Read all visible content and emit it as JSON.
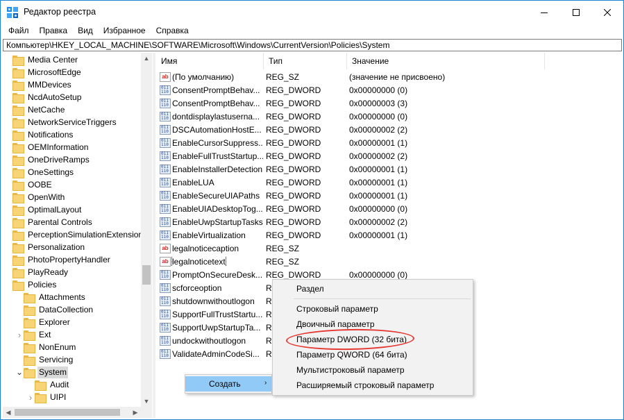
{
  "window": {
    "title": "Редактор реестра",
    "controls": {
      "minimize": "minimize",
      "maximize": "maximize",
      "close": "close"
    }
  },
  "menubar": [
    "Файл",
    "Правка",
    "Вид",
    "Избранное",
    "Справка"
  ],
  "address": "Компьютер\\HKEY_LOCAL_MACHINE\\SOFTWARE\\Microsoft\\Windows\\CurrentVersion\\Policies\\System",
  "tree": {
    "items": [
      {
        "label": "Media Center",
        "level": 0,
        "expander": ""
      },
      {
        "label": "MicrosoftEdge",
        "level": 0,
        "expander": ""
      },
      {
        "label": "MMDevices",
        "level": 0,
        "expander": ""
      },
      {
        "label": "NcdAutoSetup",
        "level": 0,
        "expander": ""
      },
      {
        "label": "NetCache",
        "level": 0,
        "expander": ""
      },
      {
        "label": "NetworkServiceTriggers",
        "level": 0,
        "expander": ""
      },
      {
        "label": "Notifications",
        "level": 0,
        "expander": ""
      },
      {
        "label": "OEMInformation",
        "level": 0,
        "expander": ""
      },
      {
        "label": "OneDriveRamps",
        "level": 0,
        "expander": ""
      },
      {
        "label": "OneSettings",
        "level": 0,
        "expander": ""
      },
      {
        "label": "OOBE",
        "level": 0,
        "expander": ""
      },
      {
        "label": "OpenWith",
        "level": 0,
        "expander": ""
      },
      {
        "label": "OptimalLayout",
        "level": 0,
        "expander": ""
      },
      {
        "label": "Parental Controls",
        "level": 0,
        "expander": ""
      },
      {
        "label": "PerceptionSimulationExtensions",
        "level": 0,
        "expander": ""
      },
      {
        "label": "Personalization",
        "level": 0,
        "expander": ""
      },
      {
        "label": "PhotoPropertyHandler",
        "level": 0,
        "expander": ""
      },
      {
        "label": "PlayReady",
        "level": 0,
        "expander": ""
      },
      {
        "label": "Policies",
        "level": 0,
        "expander": ""
      },
      {
        "label": "Attachments",
        "level": 1,
        "expander": ""
      },
      {
        "label": "DataCollection",
        "level": 1,
        "expander": ""
      },
      {
        "label": "Explorer",
        "level": 1,
        "expander": ""
      },
      {
        "label": "Ext",
        "level": 1,
        "expander": ">"
      },
      {
        "label": "NonEnum",
        "level": 1,
        "expander": ""
      },
      {
        "label": "Servicing",
        "level": 1,
        "expander": ""
      },
      {
        "label": "System",
        "level": 1,
        "expander": "v",
        "selected": true
      },
      {
        "label": "Audit",
        "level": 2,
        "expander": ""
      },
      {
        "label": "UIPI",
        "level": 2,
        "expander": ">"
      }
    ]
  },
  "list": {
    "headers": {
      "name": "Имя",
      "type": "Тип",
      "value": "Значение"
    },
    "rows": [
      {
        "icon": "string-value-icon",
        "name": "(По умолчанию)",
        "type": "REG_SZ",
        "value": "(значение не присвоено)"
      },
      {
        "icon": "dword-value-icon",
        "name": "ConsentPromptBehav...",
        "type": "REG_DWORD",
        "value": "0x00000000 (0)"
      },
      {
        "icon": "dword-value-icon",
        "name": "ConsentPromptBehav...",
        "type": "REG_DWORD",
        "value": "0x00000003 (3)"
      },
      {
        "icon": "dword-value-icon",
        "name": "dontdisplaylastuserna...",
        "type": "REG_DWORD",
        "value": "0x00000000 (0)"
      },
      {
        "icon": "dword-value-icon",
        "name": "DSCAutomationHostE...",
        "type": "REG_DWORD",
        "value": "0x00000002 (2)"
      },
      {
        "icon": "dword-value-icon",
        "name": "EnableCursorSuppress...",
        "type": "REG_DWORD",
        "value": "0x00000001 (1)"
      },
      {
        "icon": "dword-value-icon",
        "name": "EnableFullTrustStartup...",
        "type": "REG_DWORD",
        "value": "0x00000002 (2)"
      },
      {
        "icon": "dword-value-icon",
        "name": "EnableInstallerDetection",
        "type": "REG_DWORD",
        "value": "0x00000001 (1)"
      },
      {
        "icon": "dword-value-icon",
        "name": "EnableLUA",
        "type": "REG_DWORD",
        "value": "0x00000001 (1)"
      },
      {
        "icon": "dword-value-icon",
        "name": "EnableSecureUIAPaths",
        "type": "REG_DWORD",
        "value": "0x00000001 (1)"
      },
      {
        "icon": "dword-value-icon",
        "name": "EnableUIADesktopTog...",
        "type": "REG_DWORD",
        "value": "0x00000000 (0)"
      },
      {
        "icon": "dword-value-icon",
        "name": "EnableUwpStartupTasks",
        "type": "REG_DWORD",
        "value": "0x00000002 (2)"
      },
      {
        "icon": "dword-value-icon",
        "name": "EnableVirtualization",
        "type": "REG_DWORD",
        "value": "0x00000001 (1)"
      },
      {
        "icon": "string-value-icon",
        "name": "legalnoticecaption",
        "type": "REG_SZ",
        "value": ""
      },
      {
        "icon": "string-value-icon",
        "name": "legalnoticetext",
        "type": "REG_SZ",
        "value": "",
        "focused": true
      },
      {
        "icon": "dword-value-icon",
        "name": "PromptOnSecureDesk...",
        "type": "REG_DWORD",
        "value": "0x00000000 (0)"
      },
      {
        "icon": "dword-value-icon",
        "name": "scforceoption",
        "type": "RI",
        "value": ""
      },
      {
        "icon": "dword-value-icon",
        "name": "shutdownwithoutlogon",
        "type": "RI",
        "value": ""
      },
      {
        "icon": "dword-value-icon",
        "name": "SupportFullTrustStartu...",
        "type": "RI",
        "value": ""
      },
      {
        "icon": "dword-value-icon",
        "name": "SupportUwpStartupTa...",
        "type": "RI",
        "value": ""
      },
      {
        "icon": "dword-value-icon",
        "name": "undockwithoutlogon",
        "type": "RI",
        "value": ""
      },
      {
        "icon": "dword-value-icon",
        "name": "ValidateAdminCodeSi...",
        "type": "RI",
        "value": ""
      }
    ]
  },
  "context_menu": {
    "parent_label": "Создать",
    "submenu": [
      {
        "label": "Раздел",
        "group": 0
      },
      {
        "label": "Строковый параметр",
        "group": 1
      },
      {
        "label": "Двоичный параметр",
        "group": 1
      },
      {
        "label": "Параметр DWORD (32 бита)",
        "group": 1,
        "circled": true
      },
      {
        "label": "Параметр QWORD (64 бита)",
        "group": 1
      },
      {
        "label": "Мультистроковый параметр",
        "group": 1
      },
      {
        "label": "Расширяемый строковый параметр",
        "group": 1
      }
    ],
    "annotation_color": "#e53935"
  },
  "colors": {
    "accent_border": "#1883d7",
    "menu_highlight": "#91c9f7",
    "tree_selected": "#d9d9d9"
  }
}
